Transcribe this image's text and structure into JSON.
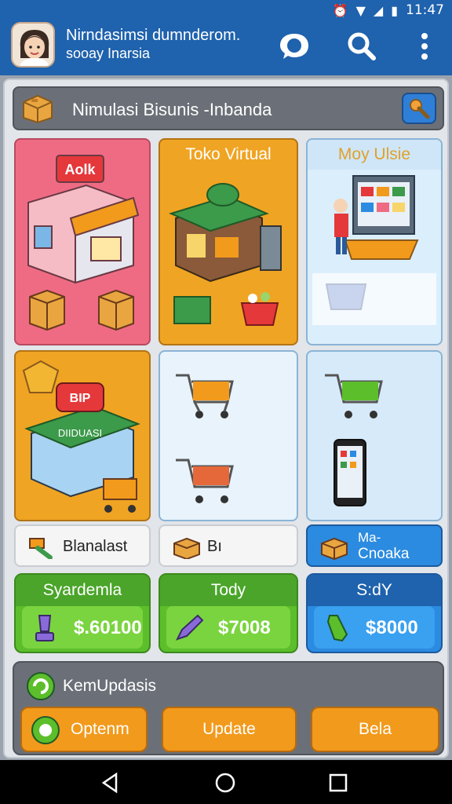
{
  "status_bar": {
    "time": "11:47"
  },
  "header": {
    "line1": "Nirndasimsi dumnderom.",
    "line2": "sooay Inarsia",
    "icons": [
      "avatar",
      "chat-bubble-icon",
      "search-icon",
      "more-vert-icon"
    ]
  },
  "panel": {
    "title": "Nimulasi Bisunis -Inbanda"
  },
  "tiles": {
    "t1": {
      "badge": "Aolk"
    },
    "t2": {
      "title": "Toko Virtual"
    },
    "t3": {
      "title": "Moy Ulsie"
    },
    "t4": {
      "sign": "DIIDUASI",
      "badge": "BIP"
    }
  },
  "buttons": {
    "b1": "Blanalast",
    "b2": "Bı",
    "b3_line1": "Ma-",
    "b3_line2": "Cnoaka"
  },
  "money": {
    "m1": {
      "title": "Syardemla",
      "value": "$.60100"
    },
    "m2": {
      "title": "Tody",
      "value": "$7008"
    },
    "m3": {
      "title": "S:dY",
      "value": "$8000"
    }
  },
  "updates": {
    "title": "KemUpdasis",
    "actions": [
      "Optenm",
      "Update",
      "Bela"
    ]
  },
  "colors": {
    "header": "#1f62ad",
    "tile_pink": "#ef6b84",
    "tile_orange": "#f0a423",
    "tile_lightblue": "#dbeefb",
    "money_green": "#5cbe2b",
    "money_blue": "#2b8be0",
    "orange_button": "#f29a1c"
  }
}
